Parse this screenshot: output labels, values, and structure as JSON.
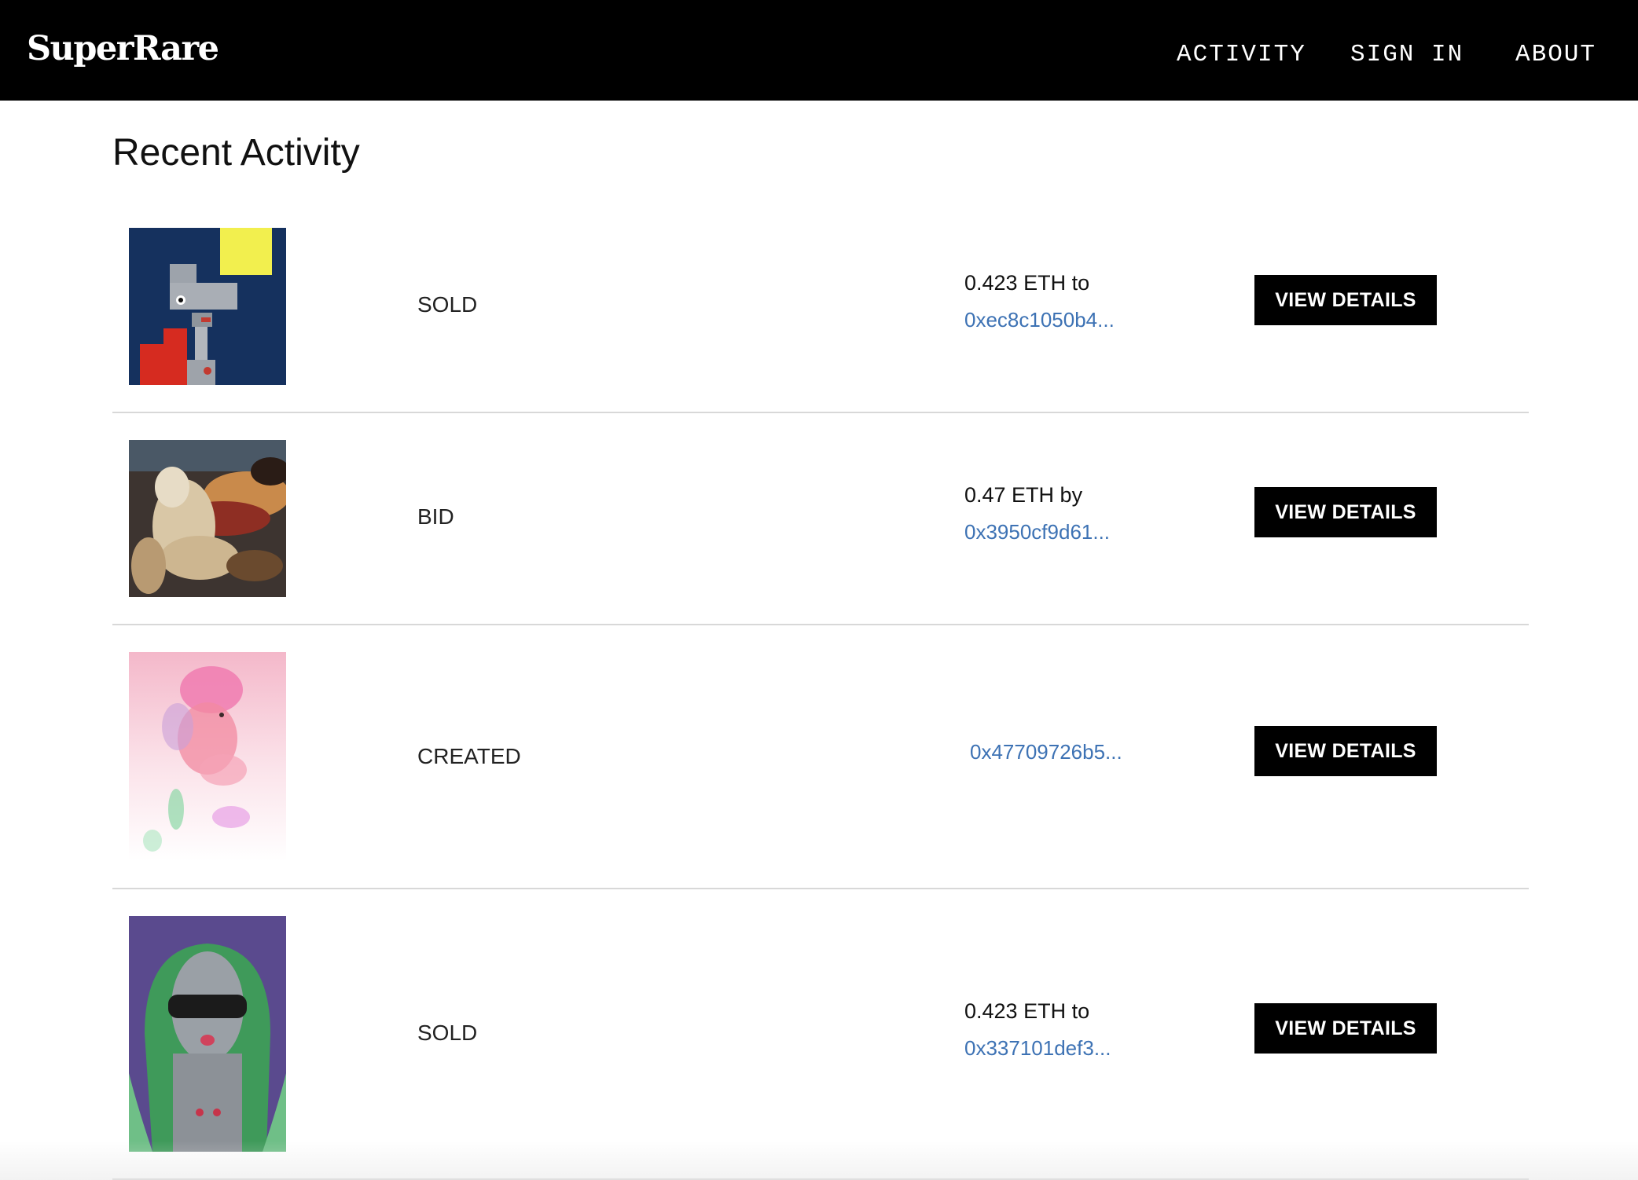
{
  "app": {
    "logo": "SuperRare"
  },
  "nav": {
    "activity": "ACTIVITY",
    "sign_in": "SIGN IN",
    "about": "ABOUT"
  },
  "page": {
    "title": "Recent Activity"
  },
  "activity": [
    {
      "event": "SOLD",
      "amount": "0.423 ETH to",
      "address": "0xec8c1050b4...",
      "button": "VIEW DETAILS",
      "artwork": "robot-figure-artwork"
    },
    {
      "event": "BID",
      "amount": "0.47 ETH by",
      "address": "0x3950cf9d61...",
      "button": "VIEW DETAILS",
      "artwork": "surreal-figures-artwork"
    },
    {
      "event": "CREATED",
      "amount": "",
      "address": "0x47709726b5...",
      "button": "VIEW DETAILS",
      "artwork": "pink-portrait-artwork"
    },
    {
      "event": "SOLD",
      "amount": "0.423 ETH to",
      "address": "0x337101def3...",
      "button": "VIEW DETAILS",
      "artwork": "green-hair-figure-artwork"
    }
  ],
  "colors": {
    "nav_bg": "#000000",
    "link": "#3d72b4",
    "divider": "#d8d8d8",
    "button_bg": "#000000"
  }
}
